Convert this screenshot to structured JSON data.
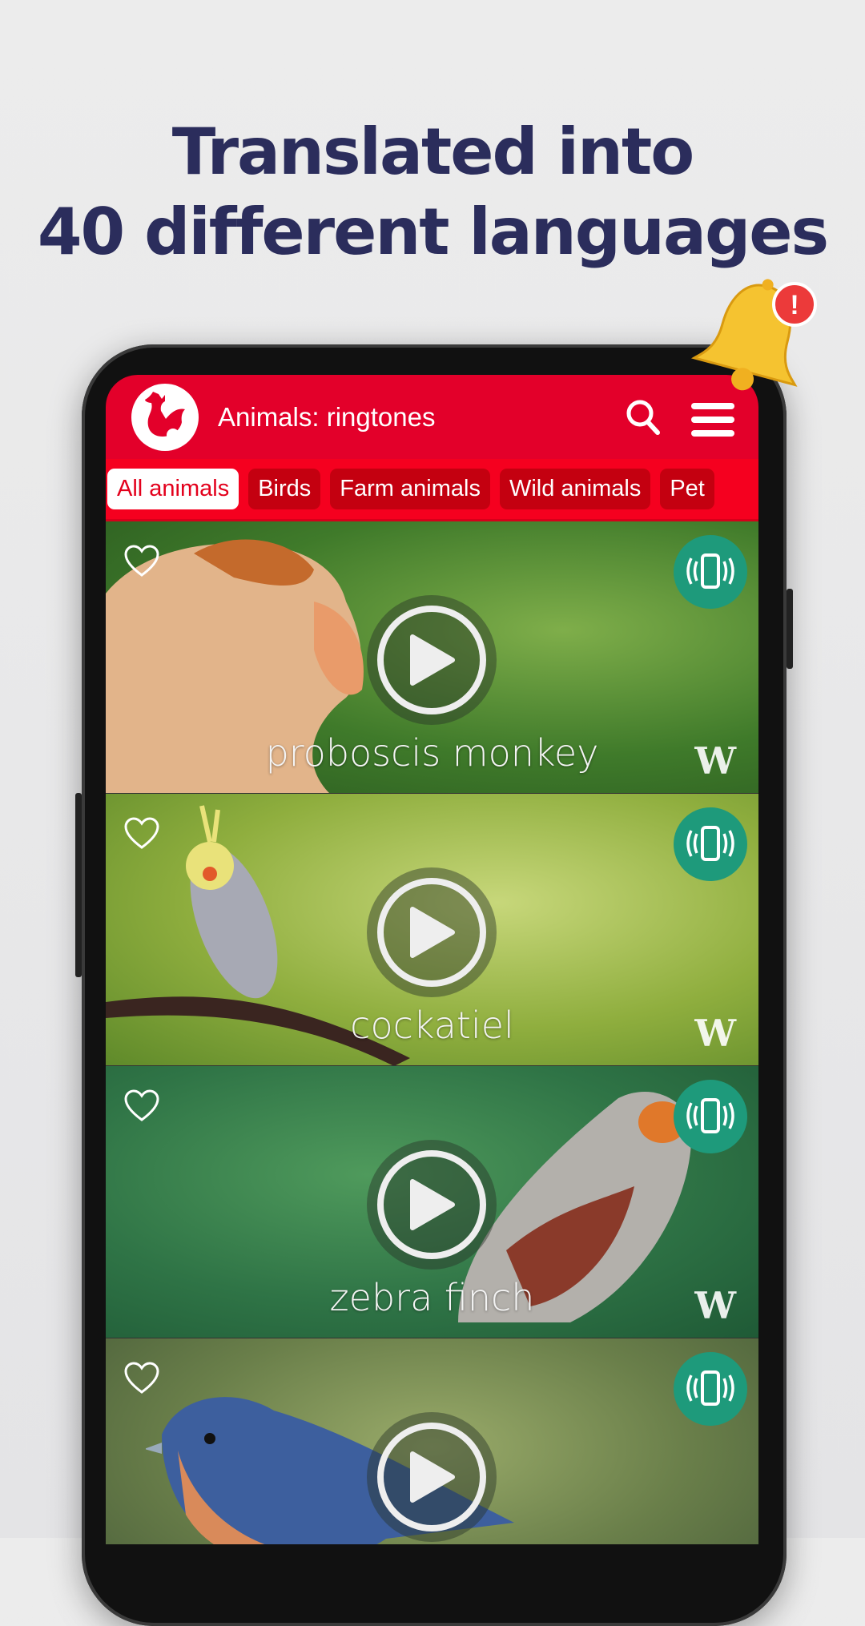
{
  "headline": {
    "line1": "Translated into",
    "line2": "40 different languages"
  },
  "appbar": {
    "title": "Animals: ringtones",
    "logo": "rooster-icon",
    "search": "search-icon",
    "menu": "hamburger-menu-icon",
    "color": "#e3002a"
  },
  "chips": [
    {
      "label": "All animals",
      "active": true
    },
    {
      "label": "Birds"
    },
    {
      "label": "Farm animals"
    },
    {
      "label": "Wild animals"
    },
    {
      "label": "Pet"
    }
  ],
  "cards": [
    {
      "name": "proboscis monkey",
      "source": "W"
    },
    {
      "name": "cockatiel",
      "source": "W"
    },
    {
      "name": "zebra finch",
      "source": "W"
    },
    {
      "name": "",
      "source": ""
    }
  ],
  "badge": {
    "icon": "bell-icon",
    "alert": "!"
  }
}
